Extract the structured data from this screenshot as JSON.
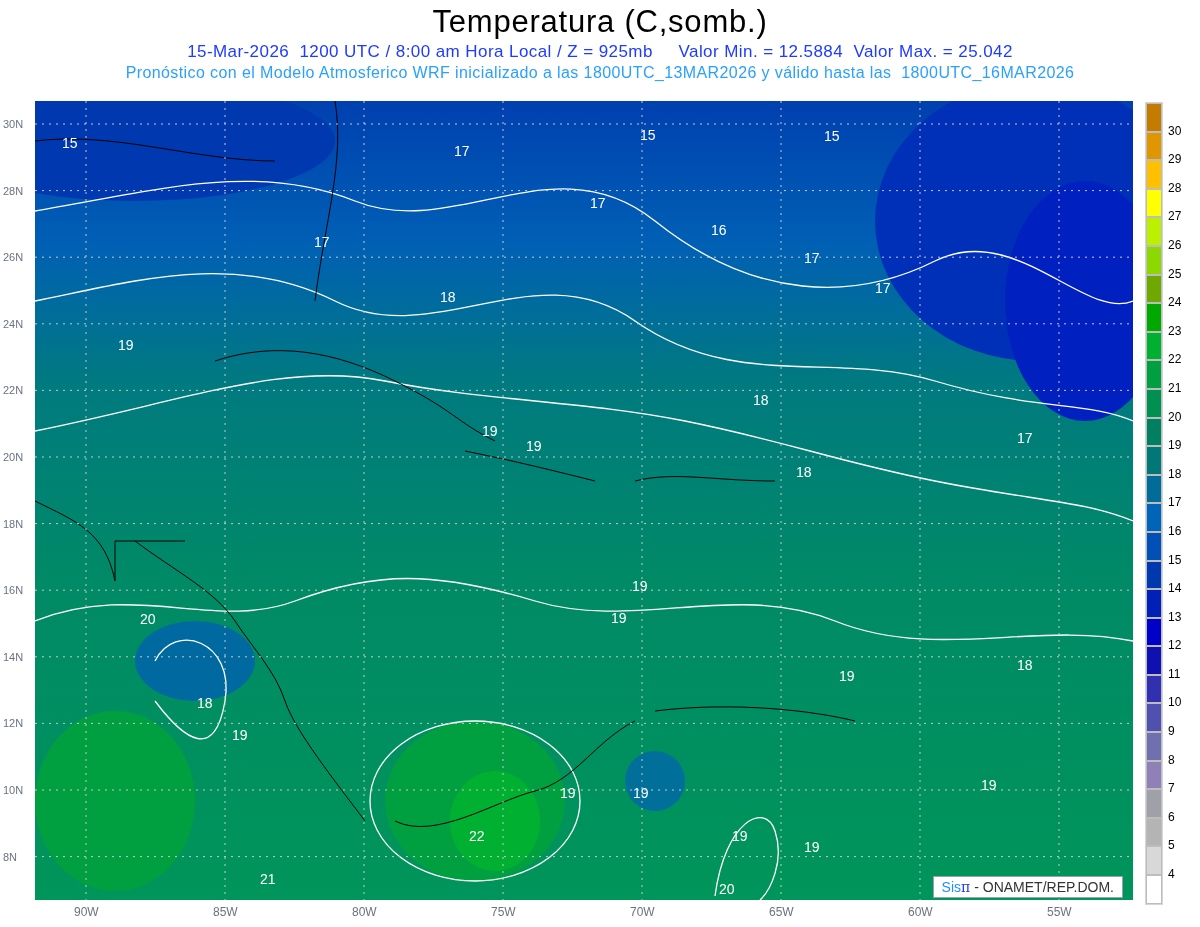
{
  "title": "Temperatura (C,somb.)",
  "subtitle": "15-Mar-2026  1200 UTC / 8:00 am Hora Local / Z = 925mb     Valor Min. = 12.5884  Valor Max. = 25.042",
  "forecast_note": "Pronóstico con el Modelo Atmosferico WRF inicializado a las 1800UTC_13MAR2026 y válido hasta las  1800UTC_16MAR2026",
  "map": {
    "latitude_labels": [
      "30N",
      "28N",
      "26N",
      "24N",
      "22N",
      "20N",
      "18N",
      "16N",
      "14N",
      "12N",
      "10N",
      "8N"
    ],
    "longitude_labels": [
      "90W",
      "85W",
      "80W",
      "75W",
      "70W",
      "65W",
      "60W",
      "55W"
    ],
    "contour_labels": [
      "15",
      "15",
      "15",
      "17",
      "17",
      "16",
      "17",
      "17",
      "17",
      "18",
      "19",
      "18",
      "17",
      "19",
      "19",
      "18",
      "19",
      "20",
      "19",
      "18",
      "19",
      "18",
      "19",
      "19",
      "19",
      "19",
      "19",
      "19",
      "22",
      "21",
      "20"
    ],
    "credit": {
      "brand_a": "Sis",
      "brand_b": "π",
      "text": "- ONAMET/REP.DOM."
    }
  },
  "colorbar": {
    "boxes": [
      {
        "color": "#c47c00"
      },
      {
        "color": "#e09600"
      },
      {
        "color": "#ffc000"
      },
      {
        "color": "#ffff00"
      },
      {
        "color": "#bbf000"
      },
      {
        "color": "#8cd800"
      },
      {
        "color": "#6ea800"
      },
      {
        "color": "#00a800"
      },
      {
        "color": "#00b030"
      },
      {
        "color": "#00a040"
      },
      {
        "color": "#009050"
      },
      {
        "color": "#008060"
      },
      {
        "color": "#007878"
      },
      {
        "color": "#006c98"
      },
      {
        "color": "#0064b8"
      },
      {
        "color": "#0050b8"
      },
      {
        "color": "#0038b0"
      },
      {
        "color": "#0020b8"
      },
      {
        "color": "#0000c8"
      },
      {
        "color": "#1010b0"
      },
      {
        "color": "#3030b0"
      },
      {
        "color": "#5050b0"
      },
      {
        "color": "#7070b0"
      },
      {
        "color": "#9080b8"
      },
      {
        "color": "#a0a0a8"
      },
      {
        "color": "#b4b4b4"
      },
      {
        "color": "#d8d8d8"
      },
      {
        "color": "#ffffff"
      }
    ],
    "labels": [
      "30",
      "29",
      "28",
      "27",
      "26",
      "25",
      "24",
      "23",
      "22",
      "21",
      "20",
      "19",
      "18",
      "17",
      "16",
      "15",
      "14",
      "13",
      "12",
      "11",
      "10",
      "9",
      "8",
      "7",
      "6",
      "5",
      "4"
    ]
  }
}
